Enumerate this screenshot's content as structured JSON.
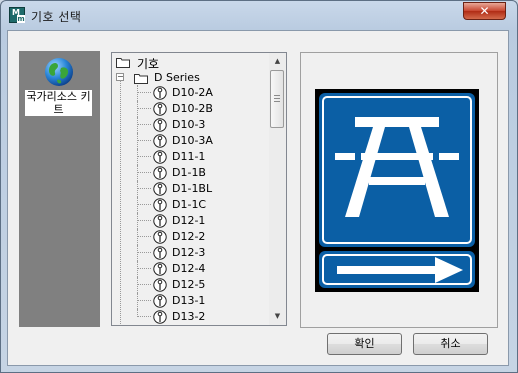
{
  "window": {
    "title": "기호 선택",
    "app_icon_letters": [
      "M",
      "m"
    ],
    "close_glyph": "✕"
  },
  "groups": [
    {
      "label": "국가리소스 키트",
      "icon": "globe-icon"
    }
  ],
  "tree": {
    "root_label": "기호",
    "series_label": "D Series",
    "expander_glyph": "−",
    "items": [
      "D10-2A",
      "D10-2B",
      "D10-3",
      "D10-3A",
      "D11-1",
      "D1-1B",
      "D1-1BL",
      "D1-1C",
      "D12-1",
      "D12-2",
      "D12-3",
      "D12-4",
      "D12-5",
      "D13-1",
      "D13-2"
    ]
  },
  "scrollbar": {
    "up_glyph": "▲",
    "down_glyph": "▼"
  },
  "preview": {
    "sign": "picnic-area-sign",
    "colors": {
      "sign_blue": "#0b5fa5",
      "sign_black": "#000000",
      "sign_white": "#ffffff"
    }
  },
  "buttons": {
    "ok": "확인",
    "cancel": "취소"
  }
}
